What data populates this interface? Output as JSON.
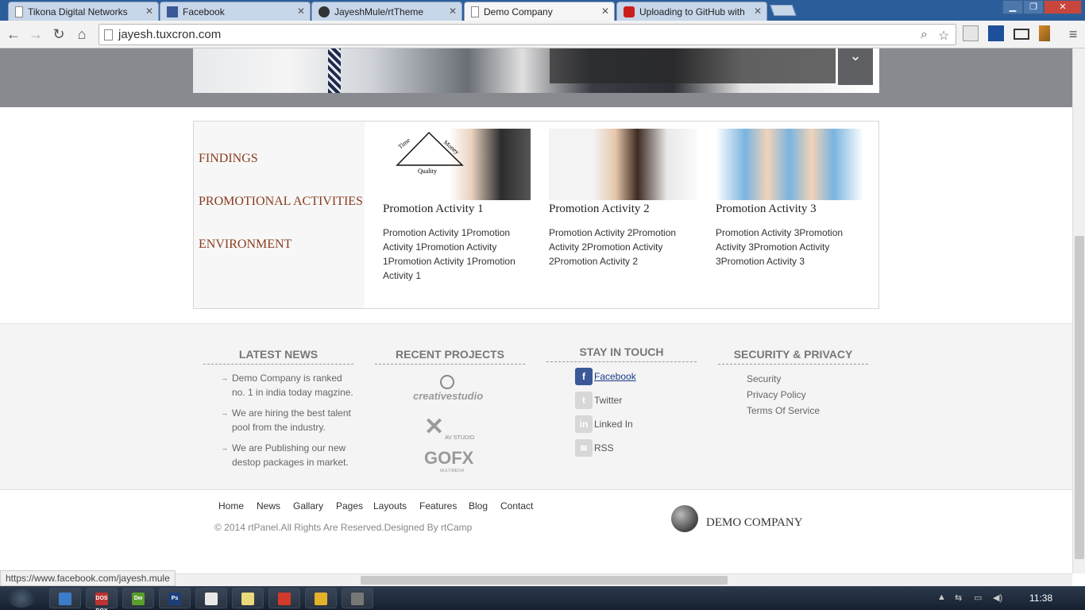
{
  "browser": {
    "tabs": [
      {
        "title": "Tikona Digital Networks",
        "active": false,
        "icon": "page-icon"
      },
      {
        "title": "Facebook",
        "active": false,
        "icon": "facebook-icon"
      },
      {
        "title": "JayeshMule/rtTheme",
        "active": false,
        "icon": "github-icon"
      },
      {
        "title": "Demo Company",
        "active": true,
        "icon": "page-icon"
      },
      {
        "title": "Uploading to GitHub with",
        "active": false,
        "icon": "youtube-icon"
      }
    ],
    "url": "jayesh.tuxcron.com",
    "status_url": "https://www.facebook.com/jayesh.mule",
    "close_glyph": "✕"
  },
  "activities": {
    "menu": [
      "FINDINGS",
      "PROMOTIONAL ACTIVITIES",
      "ENVIRONMENT"
    ],
    "cards": [
      {
        "title": "Promotion Activity 1",
        "body": "Promotion Activity 1Promotion Activity 1Promotion Activity 1Promotion Activity 1Promotion Activity 1",
        "thumb_labels": [
          "Time",
          "Money",
          "Quality"
        ]
      },
      {
        "title": "Promotion Activity 2",
        "body": "Promotion Activity 2Promotion Activity 2Promotion Activity 2Promotion Activity 2"
      },
      {
        "title": "Promotion Activity 3",
        "body": "Promotion Activity 3Promotion Activity 3Promotion Activity 3Promotion Activity 3"
      }
    ]
  },
  "footer": {
    "latest_news": {
      "title": "LATEST NEWS",
      "items": [
        "Demo Company is ranked no. 1 in india today magzine.",
        "We are hiring the best talent pool from the industry.",
        "We are Publishing our new destop packages in market."
      ]
    },
    "recent_projects": {
      "title": "RECENT PROJECTS",
      "logos": [
        {
          "name": "creativestudio",
          "text": "creativestudio"
        },
        {
          "name": "av-studio",
          "text": "AV STUDIO"
        },
        {
          "name": "gofx",
          "text": "GOFX",
          "sub": "MULTIMEDIA"
        }
      ]
    },
    "stay_in_touch": {
      "title": "STAY IN TOUCH",
      "links": [
        {
          "label": "Facebook",
          "icon": "facebook-icon",
          "glyph": "f"
        },
        {
          "label": "Twitter",
          "icon": "twitter-icon",
          "glyph": "t"
        },
        {
          "label": "Linked In",
          "icon": "linkedin-icon",
          "glyph": "in"
        },
        {
          "label": "RSS",
          "icon": "rss-icon",
          "glyph": "≋"
        }
      ]
    },
    "security": {
      "title": "SECURITY & PRIVACY",
      "links": [
        "Security",
        "Privacy Policy",
        "Terms Of Service"
      ]
    },
    "nav": [
      "Home",
      "News",
      "Gallary",
      "Pages",
      "Layouts",
      "Features",
      "Blog",
      "Contact"
    ],
    "copyright": "© 2014 rtPanel.All Rights Are Reserved.Designed By rtCamp",
    "brand": "DEMO COMPANY"
  },
  "taskbar": {
    "clock": "11:38",
    "apps": [
      {
        "name": "explorer",
        "color": "#3d7cc9",
        "text": ""
      },
      {
        "name": "dosbox",
        "color": "#b33",
        "text": "DOS BOX"
      },
      {
        "name": "dreamweaver",
        "color": "#5a9e2b",
        "text": "Dw"
      },
      {
        "name": "photoshop",
        "color": "#1c3f7a",
        "text": "Ps"
      },
      {
        "name": "word-app",
        "color": "#e8e8e8",
        "text": ""
      },
      {
        "name": "notepad",
        "color": "#e9d97a",
        "text": ""
      },
      {
        "name": "git-gui",
        "color": "#d23a2a",
        "text": ""
      },
      {
        "name": "chrome",
        "color": "#e3b12a",
        "text": ""
      },
      {
        "name": "media-app",
        "color": "#777",
        "text": ""
      }
    ]
  }
}
